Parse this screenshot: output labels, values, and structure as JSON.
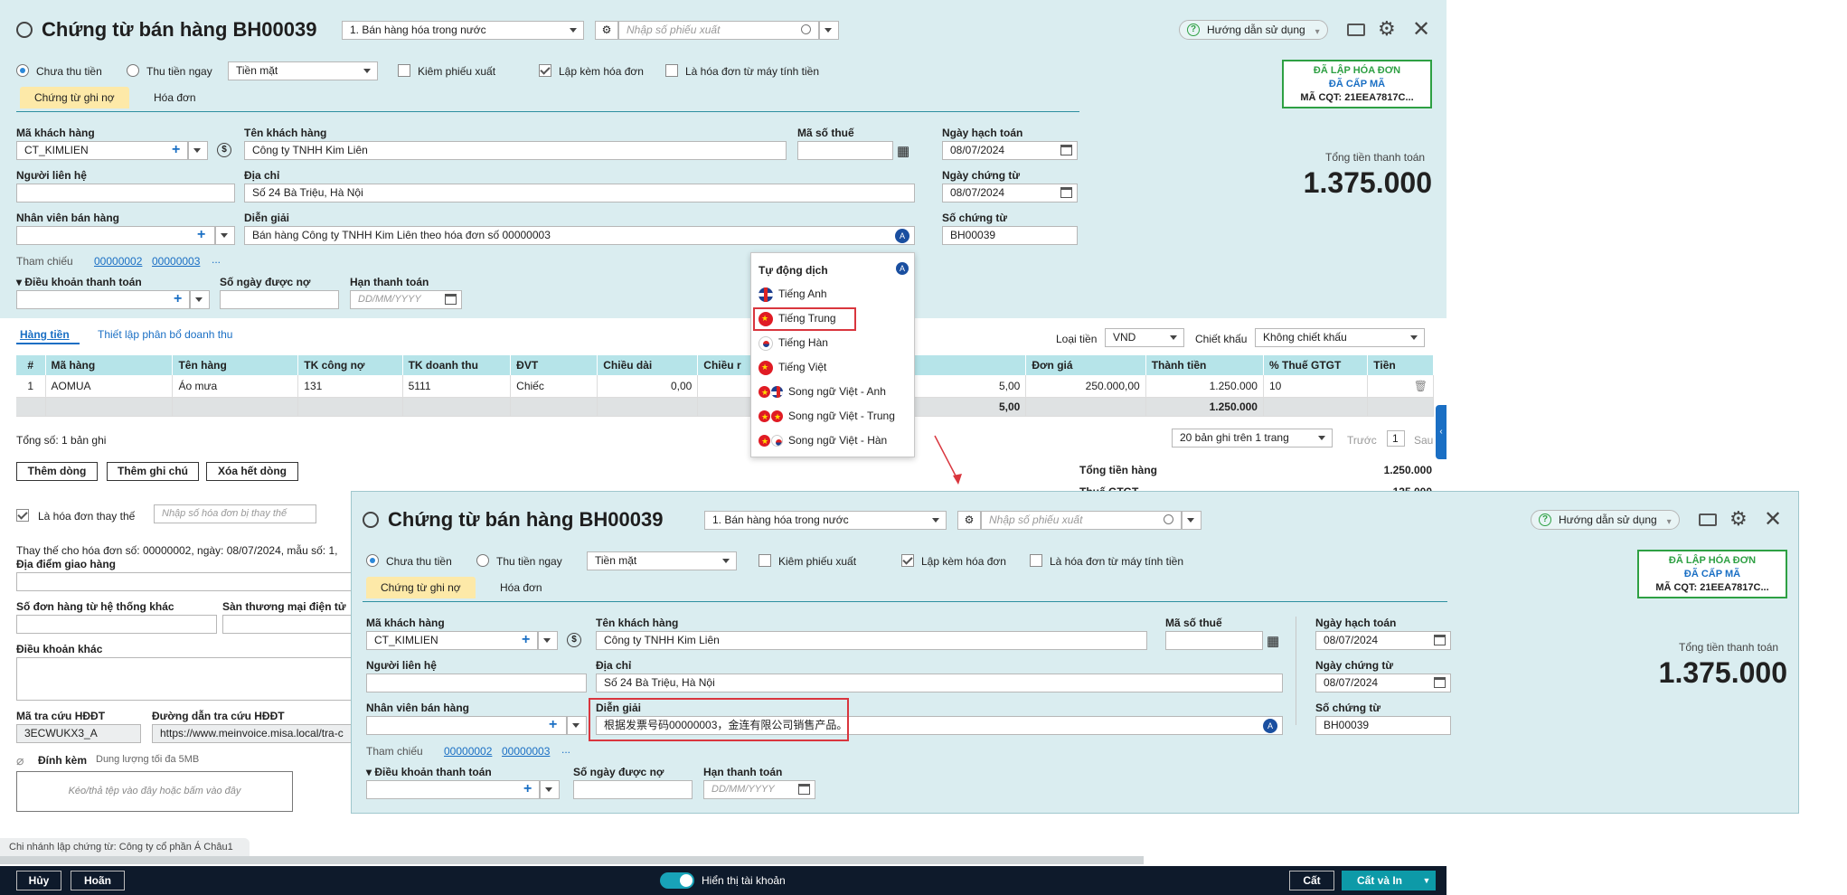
{
  "main": {
    "title": "Chứng từ bán hàng BH00039",
    "sale_type": "1. Bán hàng hóa trong nước",
    "export_placeholder": "Nhập số phiếu xuất",
    "help": "Hướng dẫn sử dụng",
    "status": {
      "line1": "ĐÃ LẬP HÓA ĐƠN",
      "line2": "ĐÃ CẤP MÃ",
      "line3": "MÃ CQT: 21EEA7817C..."
    },
    "payment": {
      "unpaid": "Chưa thu tiền",
      "paid_now": "Thu tiền ngay",
      "method": "Tiền mặt",
      "export_check": "Kiêm phiếu xuất",
      "invoice_check": "Lập kèm hóa đơn",
      "cash_register": "Là hóa đơn từ máy tính tiền"
    },
    "tabs": [
      "Chứng từ ghi nợ",
      "Hóa đơn"
    ],
    "total_label": "Tổng tiền thanh toán",
    "total_value": "1.375.000",
    "fields": {
      "customer_code_label": "Mã khách hàng",
      "customer_code": "CT_KIMLIEN",
      "customer_name_label": "Tên khách hàng",
      "customer_name": "Công ty TNHH Kim Liên",
      "tax_code_label": "Mã số thuế",
      "accounting_date_label": "Ngày hạch toán",
      "accounting_date": "08/07/2024",
      "contact_label": "Người liên hệ",
      "address_label": "Địa chỉ",
      "address": "Số 24 Bà Triệu, Hà Nội",
      "voucher_date_label": "Ngày chứng từ",
      "voucher_date": "08/07/2024",
      "salesperson_label": "Nhân viên bán hàng",
      "description_label": "Diễn giải",
      "description": "Bán hàng Công ty TNHH Kim Liên theo hóa đơn số 00000003",
      "voucher_no_label": "Số chứng từ",
      "voucher_no": "BH00039",
      "reference_label": "Tham chiếu",
      "ref1": "00000002",
      "ref2": "00000003",
      "ref_more": "...",
      "payment_terms_label": "Điều khoản thanh toán",
      "credit_days_label": "Số ngày được nợ",
      "due_date_label": "Hạn thanh toán",
      "due_date_placeholder": "DD/MM/YYYY"
    },
    "subtabs": {
      "goods": "Hàng tiền",
      "allocation": "Thiết lập phân bổ doanh thu"
    },
    "currency_label": "Loại tiền",
    "currency": "VND",
    "discount_label": "Chiết khấu",
    "discount": "Không chiết khấu",
    "table": {
      "headers": [
        "#",
        "Mã hàng",
        "Tên hàng",
        "TK công nợ",
        "TK doanh thu",
        "ĐVT",
        "Chiều dài",
        "Chiều r",
        "Số lượng",
        "Đơn giá",
        "Thành tiền",
        "% Thuế GTGT",
        "Tiền"
      ],
      "row": {
        "no": "1",
        "code": "AOMUA",
        "name": "Áo mưa",
        "debt_acc": "131",
        "rev_acc": "5111",
        "unit": "Chiếc",
        "length": "0,00",
        "qty": "5,00",
        "price": "250.000,00",
        "amount": "1.250.000",
        "vat": "10"
      },
      "foot": {
        "qty": "5,00",
        "amount": "1.250.000"
      }
    },
    "record_count": "Tổng số: 1 bản ghi",
    "paging": "20 bản ghi trên 1 trang",
    "prev": "Trước",
    "page": "1",
    "next": "Sau",
    "buttons": {
      "add_row": "Thêm dòng",
      "add_note": "Thêm ghi chú",
      "delete_rows": "Xóa hết dòng"
    },
    "summary": {
      "total_goods_label": "Tổng tiền hàng",
      "total_goods": "1.250.000",
      "vat_label": "Thuế GTGT",
      "vat": "125.000"
    },
    "replace": {
      "check": "Là hóa đơn thay thế",
      "placeholder": "Nhập số hóa đơn bị thay thế",
      "info": "Thay thế cho hóa đơn số: 00000002, ngày: 08/07/2024, mẫu số: 1,"
    },
    "delivery_label": "Địa điểm giao hàng",
    "order_no_label": "Số đơn hàng từ hệ thống khác",
    "ecommerce_label": "Sàn thương mại điện tử",
    "other_terms_label": "Điều khoản khác",
    "lookup_code_label": "Mã tra cứu HĐĐT",
    "lookup_code": "3ECWUKX3_A",
    "lookup_url_label": "Đường dẫn tra cứu HĐĐT",
    "lookup_url": "https://www.meinvoice.misa.local/tra-c",
    "attach_label": "Đính kèm",
    "attach_limit": "Dung lượng tối đa 5MB",
    "attach_drop": "Kéo/thả tệp vào đây hoặc bấm vào đây",
    "branch": "Chi nhánh lập chứng từ: Công ty cổ phần Á Châu1",
    "footer": {
      "cancel": "Hủy",
      "undo": "Hoãn",
      "show_accounts": "Hiển thị tài khoản",
      "save": "Cất",
      "save_print": "Cất và In"
    }
  },
  "dropdown": {
    "title": "Tự động dịch",
    "items": [
      "Tiếng Anh",
      "Tiếng Trung",
      "Tiếng Hàn",
      "Tiếng Việt",
      "Song ngữ Việt - Anh",
      "Song ngữ Việt - Trung",
      "Song ngữ Việt - Hàn"
    ]
  },
  "overlay": {
    "description": "根据发票号码00000003，金连有限公司销售产品。"
  },
  "colors": {
    "bg": "#daedf0",
    "accent": "#1a6fc4",
    "stamp": "#2ea043",
    "highlight": "#d9363e",
    "footer": "#0e1a2b"
  }
}
